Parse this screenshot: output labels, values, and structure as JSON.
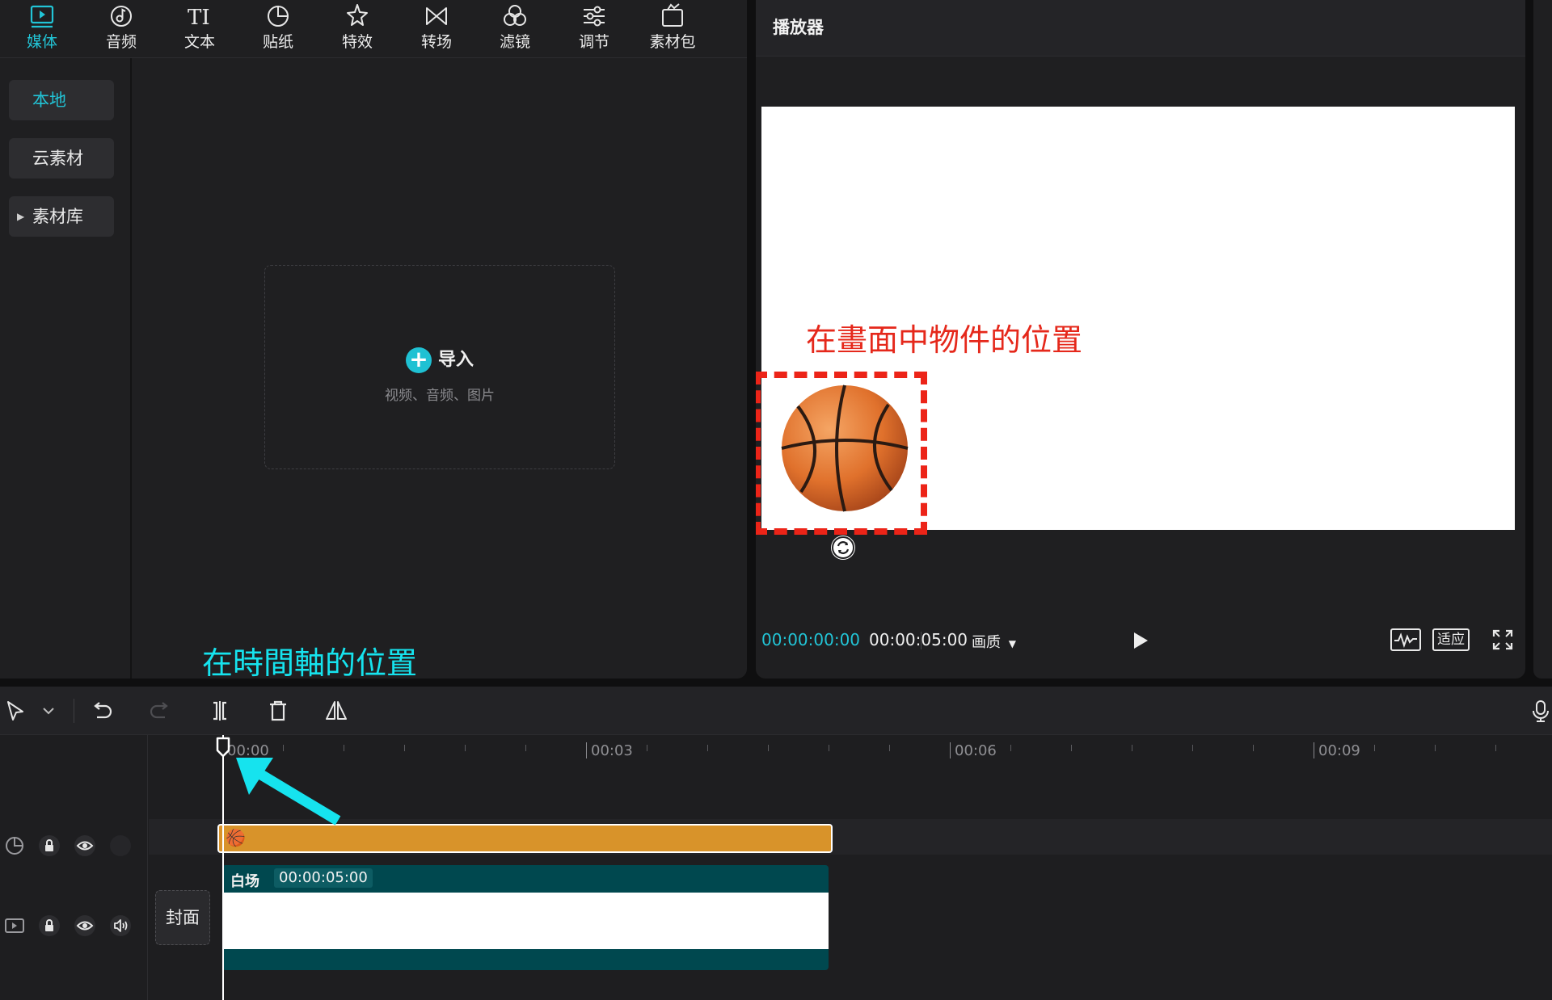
{
  "toolbar": {
    "items": [
      {
        "label": "媒体",
        "icon": "media-icon",
        "active": true
      },
      {
        "label": "音频",
        "icon": "audio-icon"
      },
      {
        "label": "文本",
        "icon": "text-icon"
      },
      {
        "label": "贴纸",
        "icon": "sticker-icon"
      },
      {
        "label": "特效",
        "icon": "effects-icon"
      },
      {
        "label": "转场",
        "icon": "transition-icon"
      },
      {
        "label": "滤镜",
        "icon": "filter-icon"
      },
      {
        "label": "调节",
        "icon": "adjust-icon"
      },
      {
        "label": "素材包",
        "icon": "package-icon"
      }
    ]
  },
  "sidebar": {
    "items": [
      {
        "label": "本地",
        "active": true
      },
      {
        "label": "云素材"
      },
      {
        "label": "素材库",
        "expandable": true
      }
    ]
  },
  "import": {
    "label": "导入",
    "sub": "视频、音频、图片"
  },
  "annotations": {
    "timeline": "在時間軸的位置",
    "canvas": "在畫面中物件的位置",
    "accent_cyan": "#16e3ee",
    "accent_red": "#e5281b"
  },
  "player": {
    "title": "播放器",
    "current_time": "00:00:00:00",
    "total_time": "00:00:05:00",
    "quality_label": "画质",
    "fit_label": "适应"
  },
  "timeline": {
    "ruler": [
      "00:00",
      "00:03",
      "00:06",
      "00:09"
    ],
    "cover_label": "封面",
    "sticker_clip": {
      "emoji": "🏀"
    },
    "video_clip": {
      "name": "白场",
      "duration": "00:00:05:00"
    }
  },
  "colors": {
    "accent": "#22c4d6",
    "sticker_clip": "#d8932a",
    "video_clip": "#00484f"
  }
}
